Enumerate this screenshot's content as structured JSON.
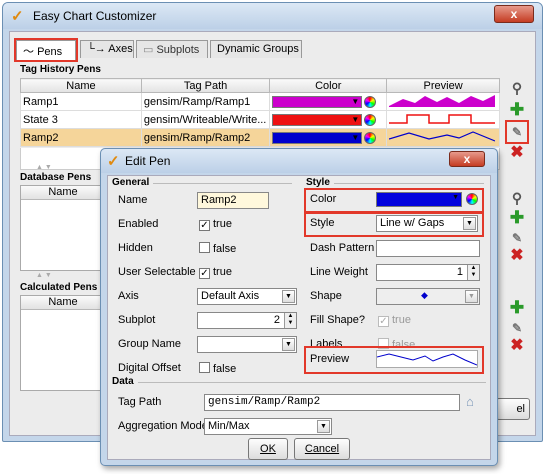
{
  "window": {
    "title": "Easy Chart Customizer",
    "close_glyph": "x"
  },
  "tabs": [
    {
      "label": "Pens",
      "icon": "line-chart-icon"
    },
    {
      "label": "Axes",
      "icon": "axes-icon"
    },
    {
      "label": "Subplots",
      "icon": "subplots-icon"
    },
    {
      "label": "Dynamic Groups"
    }
  ],
  "tag_history": {
    "section_label": "Tag History Pens",
    "columns": [
      "Name",
      "Tag Path",
      "Color",
      "Preview"
    ],
    "rows": [
      {
        "name": "Ramp1",
        "path": "gensim/Ramp/Ramp1",
        "color": "#cc00cc"
      },
      {
        "name": "State 3",
        "path": "gensim/Writeable/Write...",
        "color": "#ee1111"
      },
      {
        "name": "Ramp2",
        "path": "gensim/Ramp/Ramp2",
        "color": "#0000cc"
      }
    ]
  },
  "database": {
    "section_label": "Database Pens",
    "columns": [
      "Name"
    ]
  },
  "calculated": {
    "section_label": "Calculated Pens",
    "columns": [
      "Name"
    ]
  },
  "outer_buttons": {
    "cancel_partial": "el"
  },
  "edit_pen": {
    "title": "Edit Pen",
    "close_glyph": "x",
    "general": {
      "header": "General",
      "name_label": "Name",
      "name_value": "Ramp2",
      "enabled_label": "Enabled",
      "enabled_value": "true",
      "hidden_label": "Hidden",
      "hidden_value": "false",
      "user_selectable_label": "User Selectable",
      "user_selectable_value": "true",
      "axis_label": "Axis",
      "axis_value": "Default Axis",
      "subplot_label": "Subplot",
      "subplot_value": "2",
      "group_label": "Group Name",
      "group_value": "",
      "digital_offset_label": "Digital Offset",
      "digital_offset_value": "false"
    },
    "style": {
      "header": "Style",
      "color_label": "Color",
      "color_value": "#0000dd",
      "style_label": "Style",
      "style_value": "Line w/ Gaps",
      "dash_label": "Dash Pattern",
      "dash_value": "",
      "weight_label": "Line Weight",
      "weight_value": "1",
      "shape_label": "Shape",
      "fill_label": "Fill Shape?",
      "fill_value": "true",
      "labels_label": "Labels",
      "labels_value": "false",
      "preview_label": "Preview"
    },
    "data": {
      "header": "Data",
      "tag_path_label": "Tag Path",
      "tag_path_value": "gensim/Ramp/Ramp2",
      "aggregation_label": "Aggregation Mode",
      "aggregation_value": "Min/Max"
    },
    "buttons": {
      "ok": "OK",
      "cancel": "Cancel"
    }
  },
  "colors": {
    "highlight": "#e2382a",
    "selected_row": "#f5d59a"
  }
}
